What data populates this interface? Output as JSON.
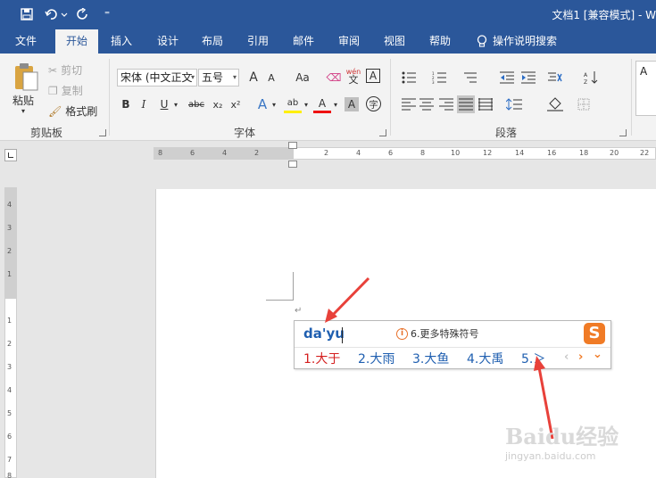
{
  "window": {
    "title": "文档1 [兼容模式] - W"
  },
  "quick_access": {
    "customize_label": "⁼"
  },
  "tabs": [
    {
      "label": "文件"
    },
    {
      "label": "开始"
    },
    {
      "label": "插入"
    },
    {
      "label": "设计"
    },
    {
      "label": "布局"
    },
    {
      "label": "引用"
    },
    {
      "label": "邮件"
    },
    {
      "label": "审阅"
    },
    {
      "label": "视图"
    },
    {
      "label": "帮助"
    }
  ],
  "tell_me": {
    "label": "操作说明搜索"
  },
  "clipboard": {
    "paste_label": "粘贴",
    "cut_label": "剪切",
    "copy_label": "复制",
    "format_painter_label": "格式刷",
    "group_label": "剪贴板"
  },
  "font": {
    "font_name": "宋体 (中文正文",
    "font_size": "五号",
    "grow_label": "A",
    "shrink_label": "A",
    "case_label": "Aa",
    "phonetic_label": "wén",
    "phonetic_char": "文",
    "border_char_label": "A",
    "bold": "B",
    "italic": "I",
    "underline": "U",
    "strike": "abc",
    "subscript": "x₂",
    "superscript": "x²",
    "effects_label": "A",
    "highlight_label": "ab",
    "color_label": "A",
    "shading_label": "A",
    "enclose_label": "字",
    "group_label": "字体"
  },
  "paragraph": {
    "group_label": "段落"
  },
  "styles": {
    "preview_label": "A"
  },
  "ruler": {
    "h_labels": [
      "8",
      "6",
      "4",
      "2",
      "2",
      "4",
      "6",
      "8",
      "10",
      "12",
      "14",
      "16",
      "18",
      "20",
      "22"
    ],
    "v_labels": [
      "4",
      "3",
      "2",
      "1",
      "1",
      "2",
      "3",
      "4",
      "5",
      "6",
      "7",
      "8"
    ]
  },
  "document": {
    "paragraph_mark": "↵"
  },
  "ime": {
    "input": "da'yu",
    "hint": "6.更多特殊符号",
    "info_icon": "i",
    "logo": "S",
    "candidates": [
      {
        "label": "1.大于"
      },
      {
        "label": "2.大雨"
      },
      {
        "label": "3.大鱼"
      },
      {
        "label": "4.大禹"
      },
      {
        "label": "5.＞"
      }
    ],
    "prev_label": "‹",
    "next_label": "›",
    "expand_label": "⌄"
  },
  "colors": {
    "titlebar": "#2b579a",
    "ribbon": "#f3f3f3",
    "candidate_first": "#d41e1e",
    "candidate": "#1f5fb0",
    "ime_accent": "#f07b26",
    "arrow": "#e8413a"
  },
  "watermark": {
    "brand": "Baidu经验",
    "url": "jingyan.baidu.com"
  }
}
